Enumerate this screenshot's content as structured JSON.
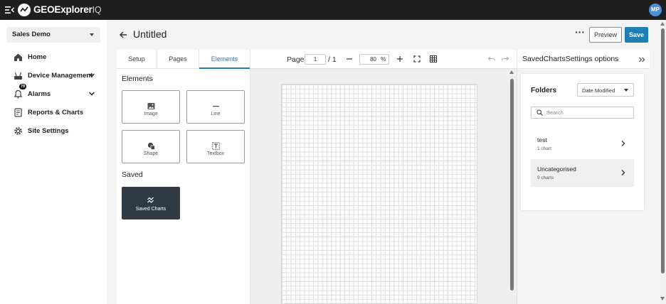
{
  "app": {
    "brand_name": "GEOExplorer",
    "brand_suffix": "IQ",
    "user_initials": "MP"
  },
  "sidebar": {
    "site_selector": "Sales Demo",
    "items": [
      {
        "label": "Home",
        "icon": "home-icon"
      },
      {
        "label": "Device Management",
        "icon": "router-icon"
      },
      {
        "label": "Alarms",
        "icon": "bell-icon",
        "badge": "79"
      },
      {
        "label": "Reports & Charts",
        "icon": "report-icon"
      },
      {
        "label": "Site Settings",
        "icon": "gear-icon"
      }
    ]
  },
  "header": {
    "title": "Untitled",
    "more_label": "···",
    "preview_label": "Preview",
    "save_label": "Save"
  },
  "tabs": {
    "items": [
      "Setup",
      "Pages",
      "Elements"
    ],
    "active": "Elements"
  },
  "elements_panel": {
    "section_title": "Elements",
    "tiles": [
      {
        "label": "Image",
        "icon": "image-icon"
      },
      {
        "label": "Line",
        "icon": "line-icon"
      },
      {
        "label": "Shape",
        "icon": "shape-icon"
      },
      {
        "label": "Textbox",
        "icon": "textbox-icon"
      }
    ],
    "saved_title": "Saved",
    "saved_tile": {
      "label": "Saved Charts",
      "icon": "chart-icon"
    }
  },
  "canvas_toolbar": {
    "page_label": "Page",
    "page_value": "1",
    "page_total": "/ 1",
    "zoom_value": "80",
    "zoom_unit": "%"
  },
  "right_panel": {
    "title": "SavedChartsSettings options",
    "folders_title": "Folders",
    "sort_value": "Date Modified",
    "search_placeholder": "Search",
    "folders": [
      {
        "name": "test",
        "count": "1 chart"
      },
      {
        "name": "Uncategorised",
        "count": "9 charts"
      }
    ]
  },
  "colors": {
    "accent": "#1f7fb4",
    "topbar": "#1f1f1f",
    "saved_tile": "#2f3a44"
  }
}
